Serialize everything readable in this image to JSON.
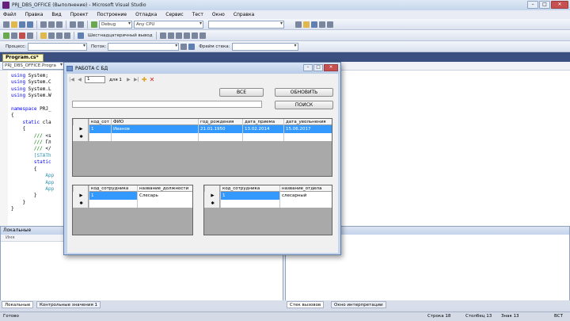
{
  "window": {
    "title": "PRJ_DBS_OFFICE (Выполнение) - Microsoft Visual Studio"
  },
  "menu": [
    "Файл",
    "Правка",
    "Вид",
    "Проект",
    "Построение",
    "Отладка",
    "Сервис",
    "Тест",
    "Окно",
    "Справка"
  ],
  "toolbar": {
    "config": "Debug",
    "platform": "Any CPU",
    "hex_label": "Шестнадцатеричный вывод",
    "process_label": "Процесс:",
    "thread_label": "Поток:",
    "frame_label": "Фрейм стека:"
  },
  "editor": {
    "tab": "Program.cs*",
    "nav": "PRJ_DBS_OFFICE.Progra",
    "lines": [
      [
        "kw",
        "using",
        " System;"
      ],
      [
        "kw",
        "using",
        " System.C"
      ],
      [
        "kw",
        "using",
        " System.L"
      ],
      [
        "kw",
        "using",
        " System.W"
      ],
      [
        "",
        "",
        ""
      ],
      [
        "kw",
        "namespace",
        " PRJ_"
      ],
      [
        "",
        "",
        "{"
      ],
      [
        "kw",
        "    static",
        " cla"
      ],
      [
        "",
        "",
        "    {"
      ],
      [
        "cm",
        "        ///",
        " <s"
      ],
      [
        "cm",
        "        ///",
        " Гл"
      ],
      [
        "cm",
        "        ///",
        " </"
      ],
      [
        "tp",
        "        [STATh",
        ""
      ],
      [
        "kw",
        "        static",
        ""
      ],
      [
        "",
        "",
        "        {"
      ],
      [
        "tp",
        "            App",
        ""
      ],
      [
        "tp",
        "            App",
        ""
      ],
      [
        "tp",
        "            App",
        ""
      ],
      [
        "",
        "",
        "        }"
      ],
      [
        "",
        "",
        "    }"
      ],
      [
        "",
        "",
        "}"
      ]
    ]
  },
  "dialog": {
    "title": "РАБОТА С БД",
    "nav": {
      "position": "1",
      "of": "для 1"
    },
    "buttons": {
      "all": "ВСЕ",
      "refresh": "ОБНОВИТЬ",
      "search": "ПОИСК"
    },
    "grid_main": {
      "columns": [
        "код_сот",
        "ФИО",
        "год_рождения",
        "дата_приема",
        "дата_увольнения"
      ],
      "rows": [
        [
          "1",
          "Иванов",
          "21.01.1950",
          "13.02.2014",
          "15.06.2017"
        ]
      ]
    },
    "grid_post": {
      "columns": [
        "код_сотрудника",
        "название_должности"
      ],
      "rows": [
        [
          "1",
          "Слесарь"
        ]
      ]
    },
    "grid_dept": {
      "columns": [
        "код_сотрудника",
        "название_отдела"
      ],
      "rows": [
        [
          "1",
          "слесарный"
        ]
      ]
    }
  },
  "panels": {
    "locals_title": "Локальные",
    "locals_col": "Имя",
    "bottom_tabs_left": [
      "Локальные",
      "Контрольные значения 1"
    ],
    "bottom_tabs_right": [
      "Стек вызовов",
      "Окно интерпретации"
    ]
  },
  "status": {
    "ready": "Готово",
    "line": "Строка 18",
    "col": "Столбец 13",
    "char": "Знак 13",
    "mode": "ВСТ"
  }
}
